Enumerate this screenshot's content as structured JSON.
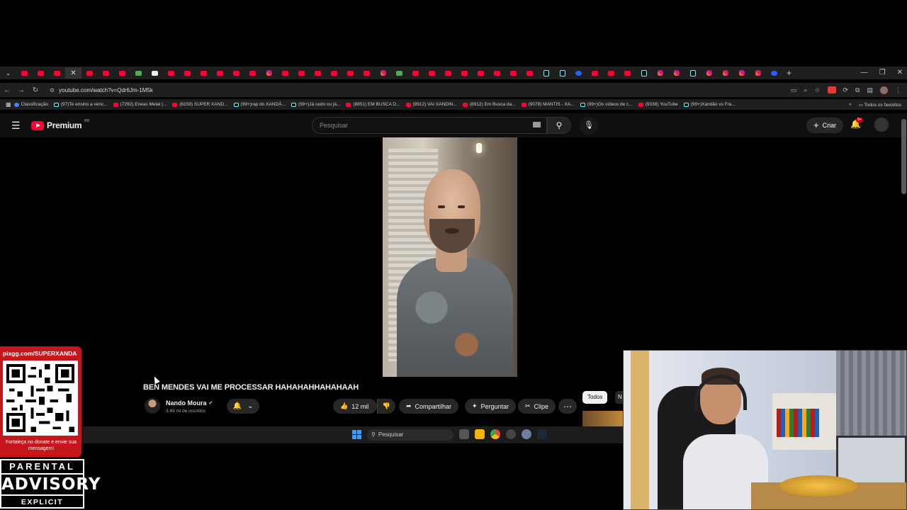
{
  "browser": {
    "url": "youtube.com/watch?v=Qdr6Jm-1M5k",
    "tabs": [
      {
        "icon": "youtube-icon"
      },
      {
        "icon": "youtube-icon"
      },
      {
        "icon": "youtube-icon"
      },
      {
        "icon": "youtube-icon"
      },
      {
        "icon": "youtube-icon"
      },
      {
        "icon": "youtube-icon"
      },
      {
        "icon": "kick-icon"
      },
      {
        "icon": "page-icon"
      },
      {
        "icon": "youtube-icon"
      },
      {
        "icon": "youtube-icon"
      },
      {
        "icon": "youtube-icon"
      },
      {
        "icon": "youtube-icon"
      },
      {
        "icon": "youtube-icon"
      },
      {
        "icon": "youtube-icon"
      },
      {
        "icon": "instagram-icon"
      },
      {
        "icon": "youtube-icon"
      },
      {
        "icon": "youtube-icon"
      },
      {
        "icon": "youtube-icon"
      },
      {
        "icon": "youtube-icon"
      },
      {
        "icon": "youtube-icon"
      },
      {
        "icon": "youtube-icon"
      },
      {
        "icon": "instagram-icon"
      },
      {
        "icon": "kick-icon"
      },
      {
        "icon": "youtube-icon"
      },
      {
        "icon": "youtube-icon"
      },
      {
        "icon": "youtube-icon"
      },
      {
        "icon": "youtube-icon"
      },
      {
        "icon": "youtube-icon"
      },
      {
        "icon": "youtube-icon"
      },
      {
        "icon": "youtube-icon"
      },
      {
        "icon": "youtube-icon"
      },
      {
        "icon": "tiktok-icon"
      },
      {
        "icon": "tiktok-icon"
      },
      {
        "icon": "facebook-icon"
      },
      {
        "icon": "youtube-icon"
      },
      {
        "icon": "youtube-icon"
      },
      {
        "icon": "youtube-icon"
      },
      {
        "icon": "tiktok-icon"
      },
      {
        "icon": "instagram-icon"
      },
      {
        "icon": "instagram-icon"
      },
      {
        "icon": "tiktok-icon"
      },
      {
        "icon": "instagram-icon"
      },
      {
        "icon": "instagram-icon"
      },
      {
        "icon": "instagram-icon"
      },
      {
        "icon": "instagram-icon"
      },
      {
        "icon": "chrome-icon"
      }
    ],
    "bookmarks": [
      {
        "label": "Classificação",
        "icon": "bookmark-icon"
      },
      {
        "label": "(97)Te ensino a venc...",
        "icon": "tiktok-icon"
      },
      {
        "label": "(7292) Enéas Metal |...",
        "icon": "youtube-icon"
      },
      {
        "label": "(8159) SUPER XAND...",
        "icon": "youtube-icon"
      },
      {
        "label": "(99+)rap do XANDÃ...",
        "icon": "tiktok-icon"
      },
      {
        "label": "(99+)Já cedo ou já...",
        "icon": "tiktok-icon"
      },
      {
        "label": "(8851) EM BUSCA D...",
        "icon": "youtube-icon"
      },
      {
        "label": "(8912) VAI XANDIN...",
        "icon": "youtube-icon"
      },
      {
        "label": "(8912) Em Busca da...",
        "icon": "youtube-icon"
      },
      {
        "label": "(9078) MANTIS - XA...",
        "icon": "youtube-icon"
      },
      {
        "label": "(99+)Os vídeos de c...",
        "icon": "tiktok-icon"
      },
      {
        "label": "(9338) YouTube",
        "icon": "youtube-icon"
      },
      {
        "label": "(99+)Xandão vs Fra...",
        "icon": "tiktok-icon"
      }
    ],
    "all_bookmarks_label": "Todos os favoritos"
  },
  "youtube": {
    "logo_text": "Premium",
    "country": "BR",
    "search_placeholder": "Pesquisar",
    "create_label": "Criar",
    "notification_badge": "9+",
    "video_title": "BEN MENDES VAI ME PROCESSAR HAHAHAHHAHAHAAH",
    "channel_name": "Nando Moura",
    "subscribers": "3,49 mi de inscritos",
    "like_count": "12 mil",
    "share_label": "Compartilhar",
    "ask_label": "Perguntar",
    "clip_label": "Clipe",
    "chip_all": "Todos",
    "chip_next": "N"
  },
  "taskbar": {
    "search_placeholder": "Pesquisar"
  },
  "overlay": {
    "pix_url": "pixgg.com/SUPERXANDA",
    "donate_message": "Fortaleça no donate e envie sua mensagem!",
    "advisory": {
      "line1": "PARENTAL",
      "line2": "ADVISORY",
      "line3": "EXPLICIT CONTENT"
    }
  },
  "colors": {
    "youtube_red": "#ff0033",
    "background": "#0f0f0f",
    "pix_panel": "#c4161c"
  }
}
